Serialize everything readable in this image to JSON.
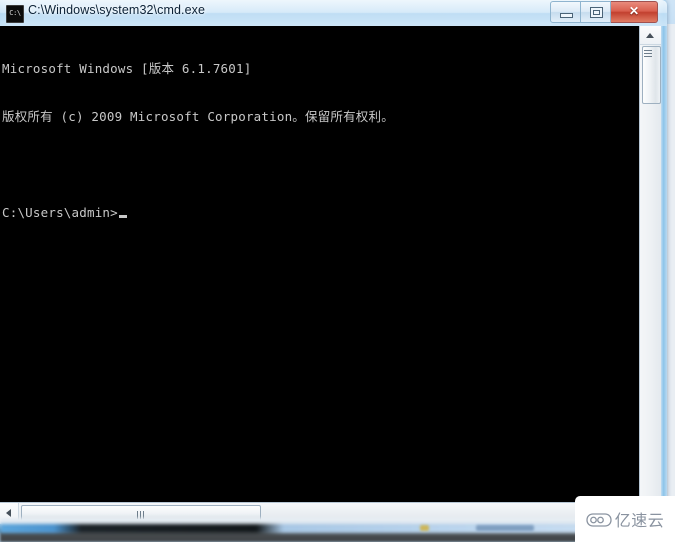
{
  "window": {
    "title": "C:\\Windows\\system32\\cmd.exe",
    "icon_name": "cmd-icon",
    "icon_glyph": "C:\\",
    "controls": {
      "minimize_label": "─",
      "maximize_label": "□",
      "close_label": "✕"
    }
  },
  "console": {
    "line1": "Microsoft Windows [版本 6.1.7601]",
    "line2": "版权所有 (c) 2009 Microsoft Corporation。保留所有权利。",
    "blank": "",
    "prompt": "C:\\Users\\admin>",
    "background": "#000000",
    "foreground": "#c8c8c8"
  },
  "scrollbars": {
    "vertical": {
      "up_arrow": "scroll-up-arrow",
      "thumb": "vertical-scroll-thumb"
    },
    "horizontal": {
      "left_arrow": "scroll-left-arrow",
      "thumb": "horizontal-scroll-thumb"
    }
  },
  "watermark": {
    "text": "亿速云",
    "logo_name": "cloud-logo-icon",
    "color": "#8a93a0"
  },
  "theme": {
    "aero_blue": "#2f93d6",
    "titlebar_text": "#0b2136",
    "close_button": "#c2402f"
  }
}
